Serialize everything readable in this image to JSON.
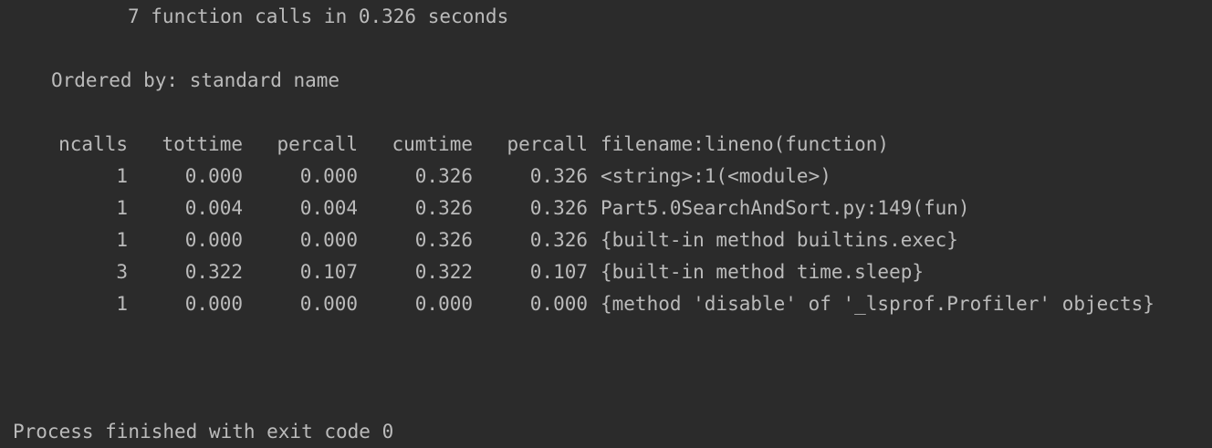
{
  "console": {
    "summary": "7 function calls in 0.326 seconds",
    "ordered_by": "Ordered by: standard name",
    "columns": [
      "ncalls",
      "tottime",
      "percall",
      "cumtime",
      "percall",
      "filename:lineno(function)"
    ],
    "rows": [
      {
        "ncalls": "1",
        "tottime": "0.000",
        "percall1": "0.000",
        "cumtime": "0.326",
        "percall2": "0.326",
        "function": "<string>:1(<module>)"
      },
      {
        "ncalls": "1",
        "tottime": "0.004",
        "percall1": "0.004",
        "cumtime": "0.326",
        "percall2": "0.326",
        "function": "Part5.0SearchAndSort.py:149(fun)"
      },
      {
        "ncalls": "1",
        "tottime": "0.000",
        "percall1": "0.000",
        "cumtime": "0.326",
        "percall2": "0.326",
        "function": "{built-in method builtins.exec}"
      },
      {
        "ncalls": "3",
        "tottime": "0.322",
        "percall1": "0.107",
        "cumtime": "0.322",
        "percall2": "0.107",
        "function": "{built-in method time.sleep}"
      },
      {
        "ncalls": "1",
        "tottime": "0.000",
        "percall1": "0.000",
        "cumtime": "0.000",
        "percall2": "0.000",
        "function": "{method 'disable' of '_lsprof.Profiler' objects}"
      }
    ],
    "exit_message": "Process finished with exit code 0"
  },
  "colors": {
    "background": "#2b2b2b",
    "text": "#bbbbbb"
  }
}
